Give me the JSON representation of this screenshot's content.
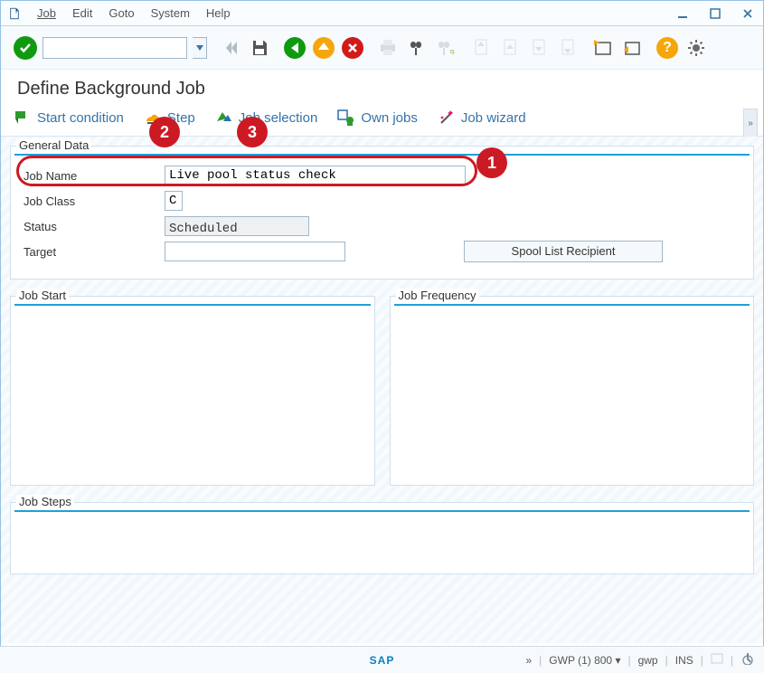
{
  "menubar": {
    "items": [
      "Job",
      "Edit",
      "Goto",
      "System",
      "Help"
    ]
  },
  "title": "Define Background Job",
  "appToolbar": {
    "startCondition": "Start condition",
    "step": "Step",
    "jobSelection": "Job selection",
    "ownJobs": "Own jobs",
    "jobWizard": "Job wizard"
  },
  "general": {
    "groupTitle": "General Data",
    "labels": {
      "jobName": "Job Name",
      "jobClass": "Job Class",
      "status": "Status",
      "target": "Target"
    },
    "jobName": "Live pool status check",
    "jobClass": "C",
    "status": "Scheduled",
    "target": "",
    "spoolBtn": "Spool List Recipient"
  },
  "sections": {
    "jobStart": "Job Start",
    "jobFrequency": "Job Frequency",
    "jobSteps": "Job Steps"
  },
  "statusbar": {
    "chevrons": "»",
    "system": "GWP (1) 800",
    "host": "gwp",
    "mode": "INS"
  },
  "callouts": [
    "1",
    "2",
    "3"
  ]
}
